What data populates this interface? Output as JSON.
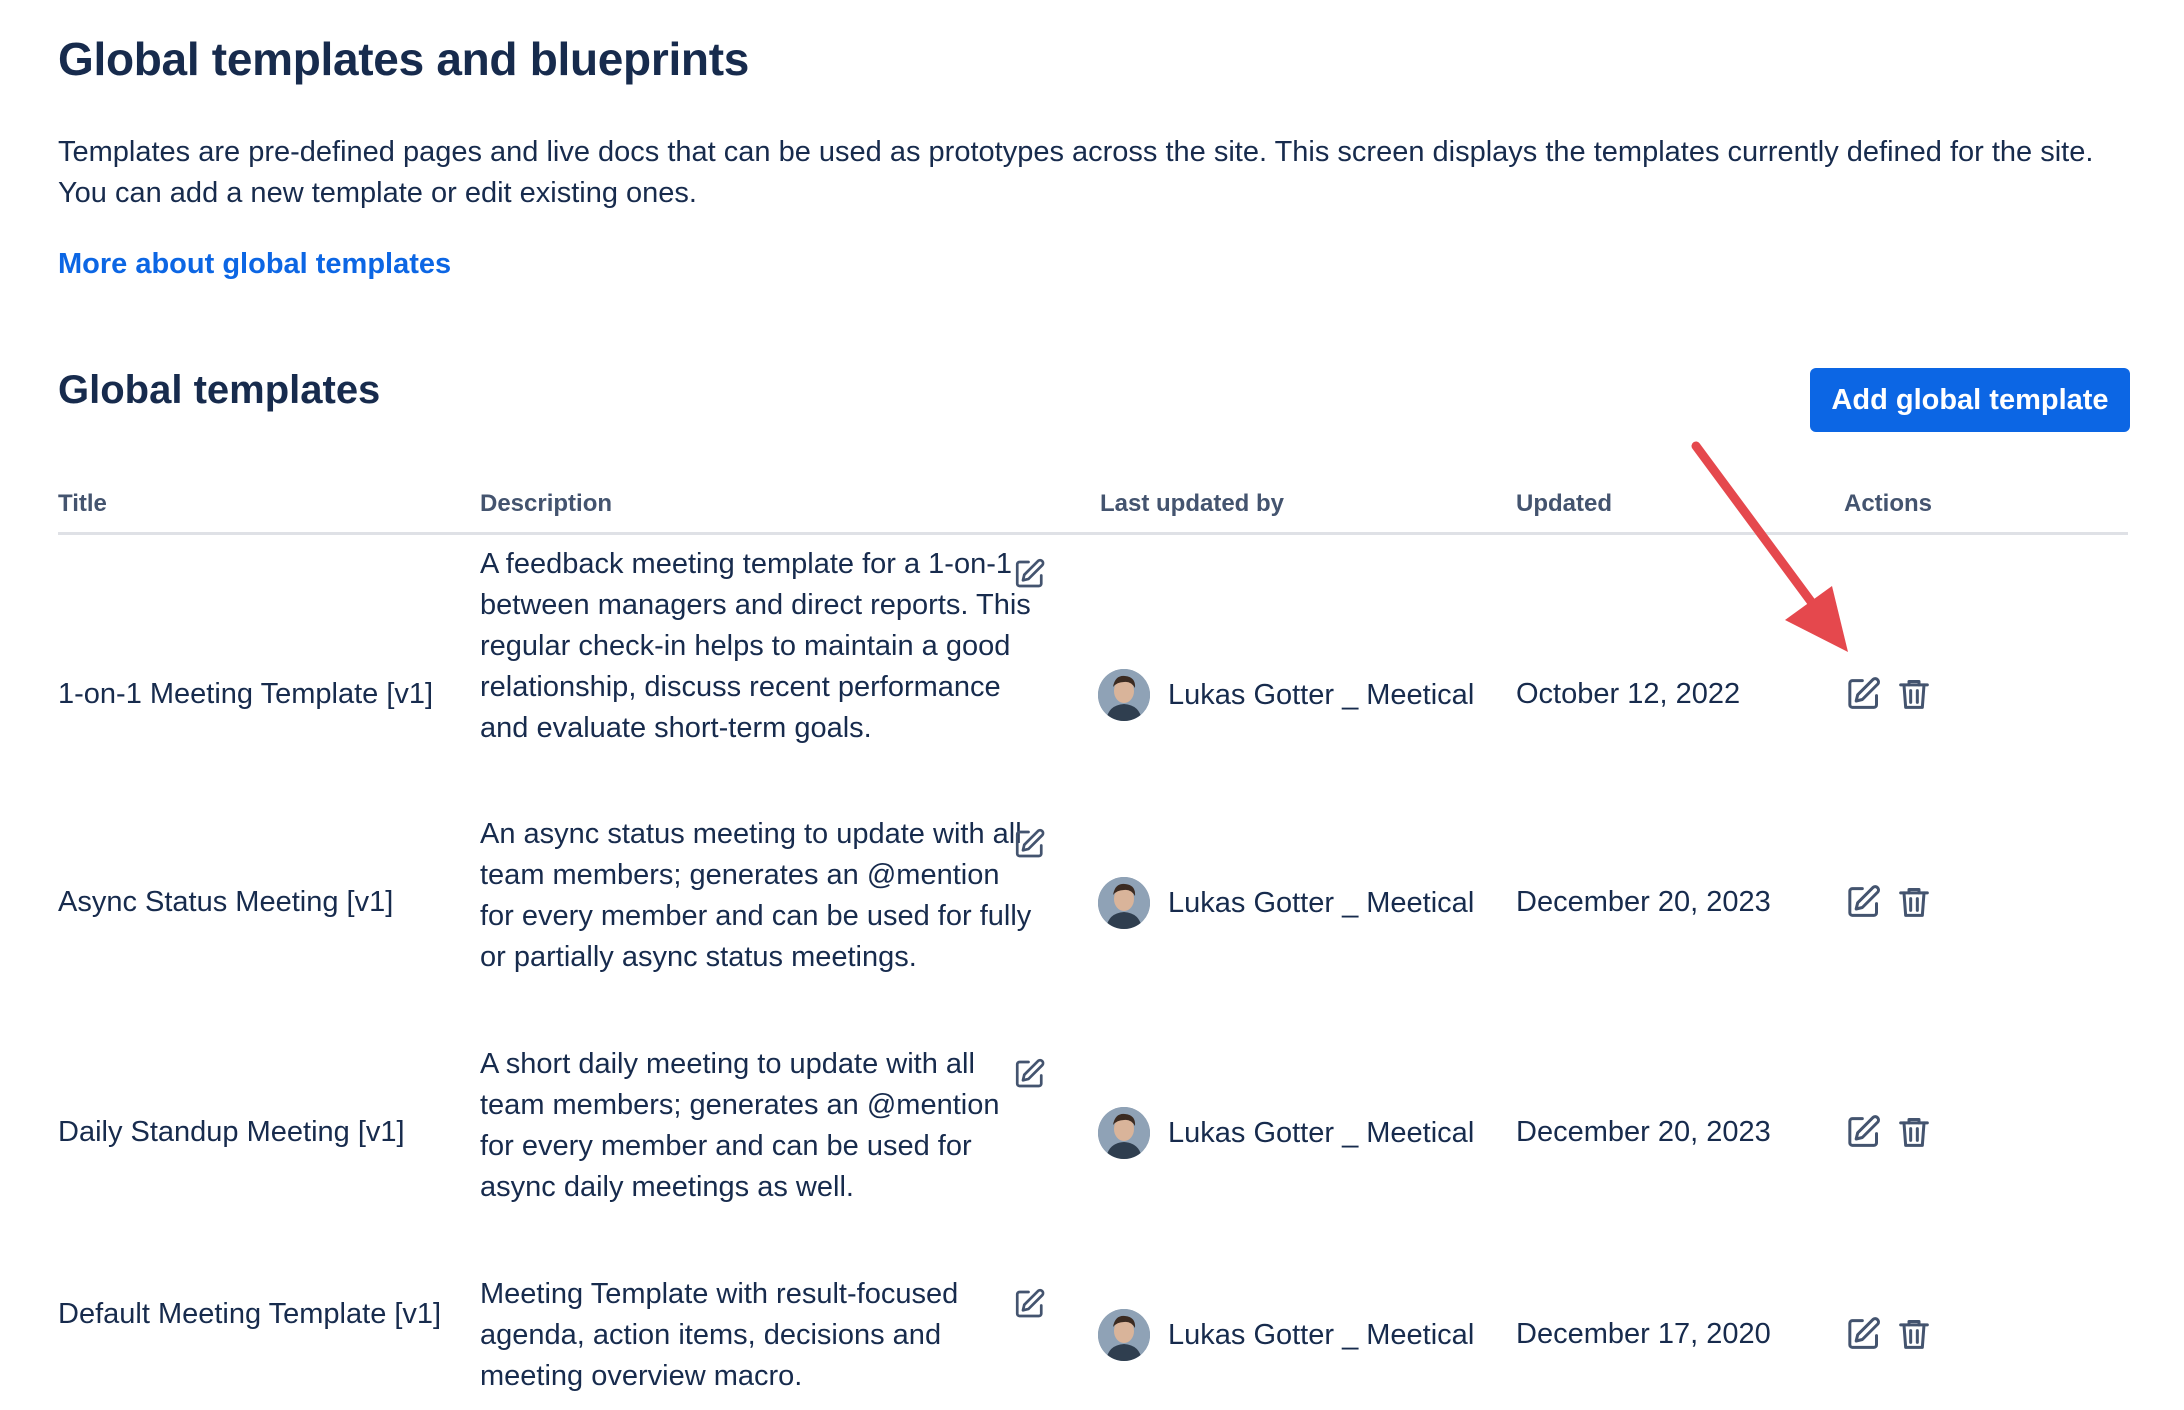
{
  "page": {
    "title": "Global templates and blueprints",
    "intro": "Templates are pre-defined pages and live docs that can be used as prototypes across the site. This screen displays the templates currently defined for the site. You can add a new template or edit existing ones.",
    "more_link": "More about global templates"
  },
  "section": {
    "title": "Global templates",
    "add_button": "Add global template"
  },
  "table": {
    "headers": {
      "title": "Title",
      "description": "Description",
      "last_updated_by": "Last updated by",
      "updated": "Updated",
      "actions": "Actions"
    },
    "rows": [
      {
        "title": "1-on-1 Meeting Template [v1]",
        "description": "A feedback meeting template for a 1-on-1 between managers and direct reports. This regular check-in helps to maintain a good relationship, discuss recent performance and evaluate short-term goals.",
        "user": "Lukas Gotter _ Meetical",
        "updated": "October 12, 2022"
      },
      {
        "title": "Async Status Meeting [v1]",
        "description": "An async status meeting to update with all team members; generates an @mention for every member and can be used for fully or partially async status meetings.",
        "user": "Lukas Gotter _ Meetical",
        "updated": "December 20, 2023"
      },
      {
        "title": "Daily Standup Meeting [v1]",
        "description": "A short daily meeting to update with all team members; generates an @mention for every member and can be used for async daily meetings as well.",
        "user": "Lukas Gotter _ Meetical",
        "updated": "December 20, 2023"
      },
      {
        "title": "Default Meeting Template [v1]",
        "description": "Meeting Template with result-focused agenda, action items, decisions and meeting overview macro.",
        "user": "Lukas Gotter _ Meetical",
        "updated": "December 17, 2020"
      }
    ]
  },
  "icons": {
    "edit": "pencil-edit-icon",
    "delete": "trash-icon",
    "annotation": "red-arrow"
  },
  "colors": {
    "link": "#0c66e4",
    "button": "#0c66e4",
    "arrow": "#e5484d",
    "text": "#172b4d",
    "header_text": "#44546f"
  }
}
